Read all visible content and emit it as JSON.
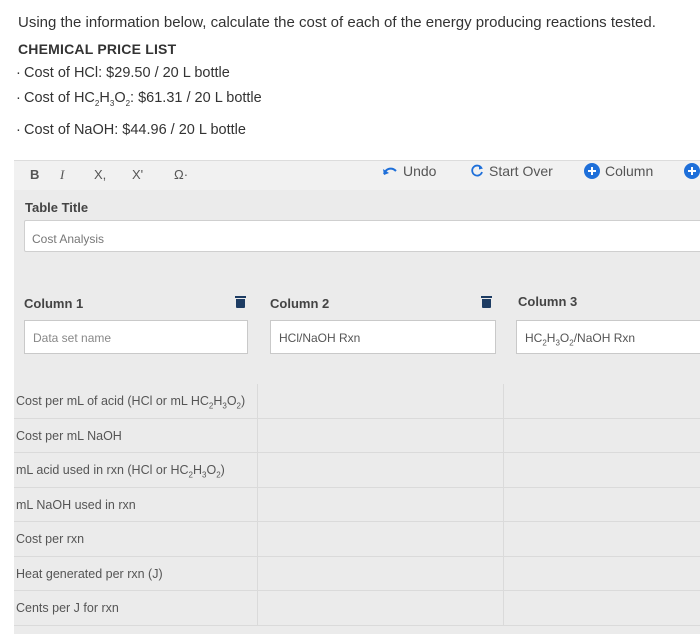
{
  "question": "Using the information below, calculate the cost of each of the energy producing reactions tested.",
  "price_list": {
    "title": "CHEMICAL PRICE LIST",
    "items": [
      {
        "label": "Cost of HCl: $29.50 / 20 L bottle"
      },
      {
        "label_html": "Cost of HC<sub>2</sub>H<sub>3</sub>O<sub>2</sub>: $61.31 / 20 L bottle",
        "label": "Cost of HC2H3O2: $61.31 / 20 L bottle"
      },
      {
        "label": "Cost of NaOH: $44.96 / 20 L bottle"
      }
    ]
  },
  "toolbar": {
    "bold": "B",
    "italic": "I",
    "subscript": "X,",
    "superscript": "X'",
    "omega": "Ω·",
    "undo": "Undo",
    "start_over": "Start Over",
    "column": "Column"
  },
  "table_title": {
    "label": "Table Title",
    "value": "Cost Analysis"
  },
  "columns": [
    {
      "header": "Column 1",
      "dataset": "",
      "placeholder": "Data set name"
    },
    {
      "header": "Column 2",
      "dataset": "HCl/NaOH Rxn"
    },
    {
      "header": "Column 3",
      "dataset": "HC2H3O2/NaOH Rxn"
    }
  ],
  "rows": [
    {
      "label": "Cost per mL of acid (HCl or mL HC2H3O2)"
    },
    {
      "label": "Cost per mL NaOH"
    },
    {
      "label": "mL acid used in rxn (HCl or HC2H3O2)"
    },
    {
      "label": "mL NaOH used in rxn"
    },
    {
      "label": "Cost per rxn"
    },
    {
      "label": "Heat generated per rxn (J)"
    },
    {
      "label": "Cents per J for rxn"
    }
  ],
  "colors": {
    "accent": "#1e6fd9",
    "trash": "#1d3c63",
    "panel_bg": "#ebebeb"
  }
}
